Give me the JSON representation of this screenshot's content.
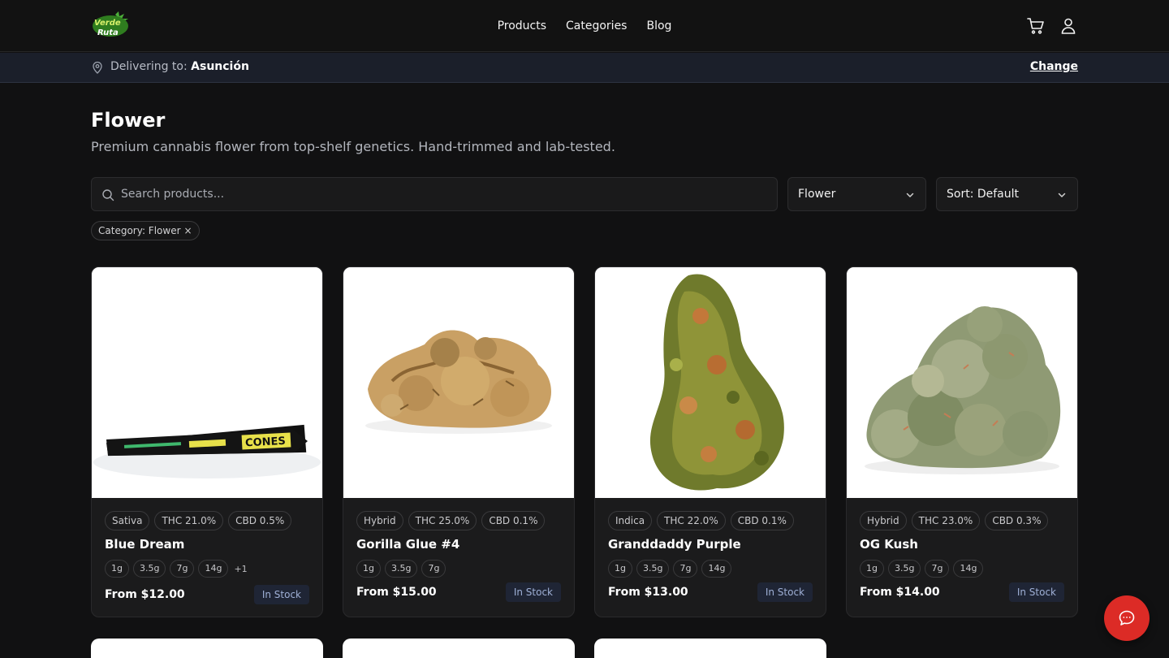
{
  "header": {
    "logo_text": "Verde Ruta",
    "nav": [
      {
        "label": "Products"
      },
      {
        "label": "Categories"
      },
      {
        "label": "Blog"
      }
    ],
    "icons": [
      "cart-icon",
      "user-icon"
    ]
  },
  "delivery": {
    "prefix": "Delivering to:",
    "city": "Asunción",
    "change_label": "Change"
  },
  "page": {
    "title": "Flower",
    "subtitle": "Premium cannabis flower from top-shelf genetics. Hand-trimmed and lab-tested."
  },
  "filters": {
    "search_placeholder": "Search products...",
    "category_value": "Flower",
    "sort_value": "Sort: Default",
    "active_chip": "Category: Flower",
    "chip_remove": "×"
  },
  "products": [
    {
      "name": "Blue Dream",
      "badges": [
        "Sativa",
        "THC 21.0%",
        "CBD 0.5%"
      ],
      "sizes": [
        "1g",
        "3.5g",
        "7g",
        "14g"
      ],
      "more": "+1",
      "price": "From $12.00",
      "stock": "In Stock",
      "image": "pre-rolled cone"
    },
    {
      "name": "Gorilla Glue #4",
      "badges": [
        "Hybrid",
        "THC 25.0%",
        "CBD 0.1%"
      ],
      "sizes": [
        "1g",
        "3.5g",
        "7g"
      ],
      "more": "",
      "price": "From $15.00",
      "stock": "In Stock",
      "image": "cannabis buds"
    },
    {
      "name": "Granddaddy Purple",
      "badges": [
        "Indica",
        "THC 22.0%",
        "CBD 0.1%"
      ],
      "sizes": [
        "1g",
        "3.5g",
        "7g",
        "14g"
      ],
      "more": "",
      "price": "From $13.00",
      "stock": "In Stock",
      "image": "cannabis bud"
    },
    {
      "name": "OG Kush",
      "badges": [
        "Hybrid",
        "THC 23.0%",
        "CBD 0.3%"
      ],
      "sizes": [
        "1g",
        "3.5g",
        "7g",
        "14g"
      ],
      "more": "",
      "price": "From $14.00",
      "stock": "In Stock",
      "image": "cannabis buds"
    }
  ],
  "colors": {
    "background": "#111112",
    "card": "#1b1b1c",
    "accent": "#dc2b26",
    "stock_bg": "#1f2535"
  }
}
